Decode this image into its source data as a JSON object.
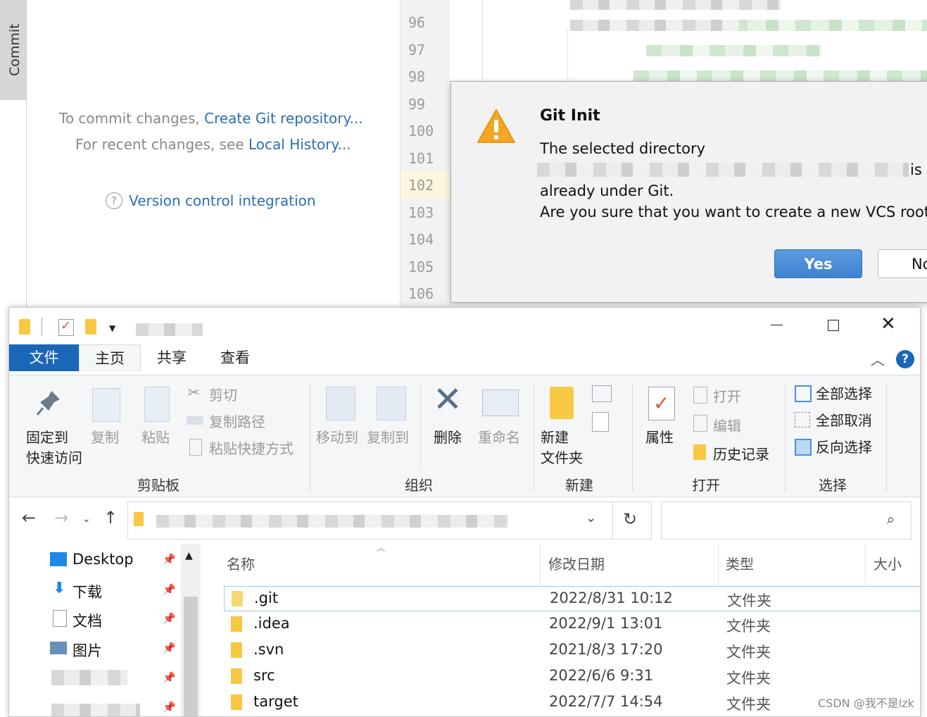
{
  "ide": {
    "commit_tab": "Commit",
    "commit_hint_prefix": "To commit changes, ",
    "commit_hint_link": "Create Git repository...",
    "history_hint_prefix": "For recent changes, see ",
    "history_hint_link": "Local History...",
    "vcs_link": "Version control integration",
    "line_numbers": [
      "96",
      "97",
      "98",
      "99",
      "100",
      "101",
      "102",
      "103",
      "104",
      "105",
      "106"
    ],
    "current_line": "102"
  },
  "dialog": {
    "title": "Git Init",
    "line1": "The selected directory",
    "is_word": "is",
    "line3": "already under Git.",
    "line4": "Are you sure that you want to create a new VCS root?",
    "yes_label": "Yes",
    "no_label": "No",
    "warning_color": "#f5a623",
    "primary_color": "#4a8bd6"
  },
  "explorer": {
    "tabs": {
      "file": "文件",
      "home": "主页",
      "share": "共享",
      "view": "查看"
    },
    "ribbon": {
      "pin": "固定到",
      "pin2": "快速访问",
      "copy": "复制",
      "paste": "粘贴",
      "cut": "剪切",
      "copy_path": "复制路径",
      "paste_shortcut": "粘贴快捷方式",
      "clipboard_group": "剪贴板",
      "move_to": "移动到",
      "copy_to": "复制到",
      "delete": "删除",
      "rename": "重命名",
      "organize_group": "组织",
      "new_folder": "新建",
      "new_folder2": "文件夹",
      "new_group": "新建",
      "properties": "属性",
      "open": "打开",
      "edit": "编辑",
      "history": "历史记录",
      "open_group": "打开",
      "select_all": "全部选择",
      "select_none": "全部取消",
      "invert_selection": "反向选择",
      "select_group": "选择"
    },
    "nav": [
      {
        "label": "Desktop",
        "icon": "desktop-icon"
      },
      {
        "label": "下载",
        "icon": "download-icon"
      },
      {
        "label": "文档",
        "icon": "document-icon"
      },
      {
        "label": "图片",
        "icon": "picture-icon"
      }
    ],
    "columns": {
      "name": "名称",
      "date": "修改日期",
      "type": "类型",
      "size": "大小"
    },
    "files": [
      {
        "name": ".git",
        "date": "2022/8/31 10:12",
        "type": "文件夹"
      },
      {
        "name": ".idea",
        "date": "2022/9/1 13:01",
        "type": "文件夹"
      },
      {
        "name": ".svn",
        "date": "2021/8/3 17:20",
        "type": "文件夹"
      },
      {
        "name": "src",
        "date": "2022/6/6 9:31",
        "type": "文件夹"
      },
      {
        "name": "target",
        "date": "2022/7/7 14:54",
        "type": "文件夹"
      }
    ]
  },
  "watermark": "CSDN @我不是lzk"
}
